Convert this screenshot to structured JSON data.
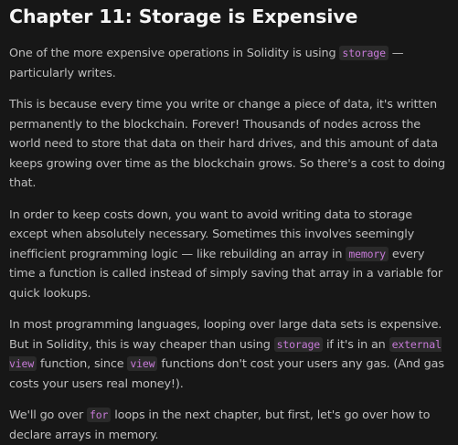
{
  "lesson": {
    "title": "Chapter 11: Storage is Expensive",
    "paragraphs": [
      {
        "segments": [
          {
            "text": "One of the more expensive operations in Solidity is using "
          },
          {
            "text": "storage",
            "code": true
          },
          {
            "text": " — particularly writes."
          }
        ]
      },
      {
        "segments": [
          {
            "text": "This is because every time you write or change a piece of data, it's written permanently to the blockchain. Forever! Thousands of nodes across the world need to store that data on their hard drives, and this amount of data keeps growing over time as the blockchain grows. So there's a cost to doing that."
          }
        ]
      },
      {
        "segments": [
          {
            "text": "In order to keep costs down, you want to avoid writing data to storage except when absolutely necessary. Sometimes this involves seemingly inefficient programming logic — like rebuilding an array in "
          },
          {
            "text": "memory",
            "code": true
          },
          {
            "text": " every time a function is called instead of simply saving that array in a variable for quick lookups."
          }
        ]
      },
      {
        "segments": [
          {
            "text": "In most programming languages, looping over large data sets is expensive. But in Solidity, this is way cheaper than using "
          },
          {
            "text": "storage",
            "code": true
          },
          {
            "text": " if it's in an "
          },
          {
            "text": "external view",
            "code": true
          },
          {
            "text": " function, since "
          },
          {
            "text": "view",
            "code": true
          },
          {
            "text": " functions don't cost your users any gas. (And gas costs your users real money!)."
          }
        ]
      },
      {
        "segments": [
          {
            "text": "We'll go over "
          },
          {
            "text": "for",
            "code": true
          },
          {
            "text": " loops in the next chapter, but first, let's go over how to declare arrays in memory."
          }
        ]
      }
    ]
  }
}
